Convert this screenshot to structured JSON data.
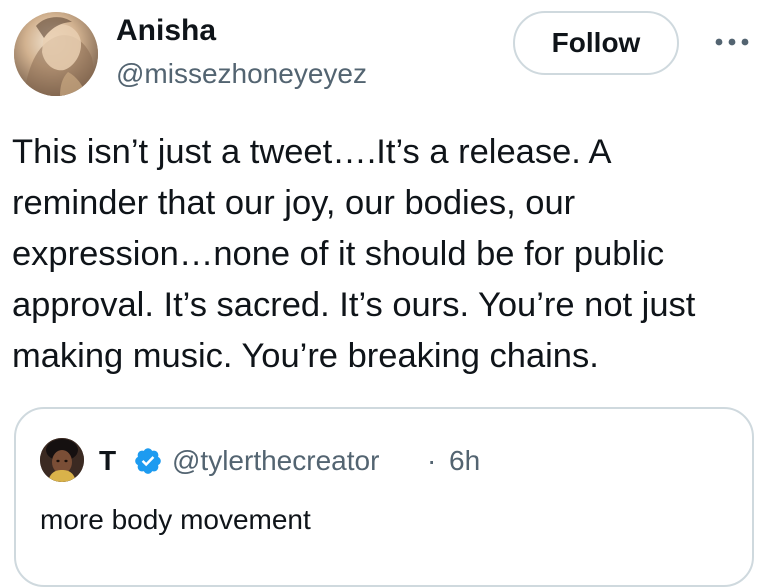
{
  "tweet": {
    "author": {
      "name": "Anisha",
      "handle": "@missezhoneyeyez"
    },
    "follow_label": "Follow",
    "more_icon": "more-horizontal-icon",
    "text_lines": [
      "This isn’t just a tweet….It’s a release. A",
      "reminder that our joy, our bodies, our",
      "expression…none of it should be for public",
      "approval. It’s sacred. It’s ours. You’re not just",
      "making music. You’re breaking chains."
    ]
  },
  "quote": {
    "author": {
      "name": "T",
      "verified_icon": "verified-badge-icon",
      "handle": "@tylerthecreator",
      "separator": "·",
      "time": "6h"
    },
    "text": "more body movement"
  },
  "colors": {
    "text_primary": "#0f1419",
    "text_secondary": "#536471",
    "border": "#cfd9de",
    "verified_blue": "#1d9bf0"
  }
}
